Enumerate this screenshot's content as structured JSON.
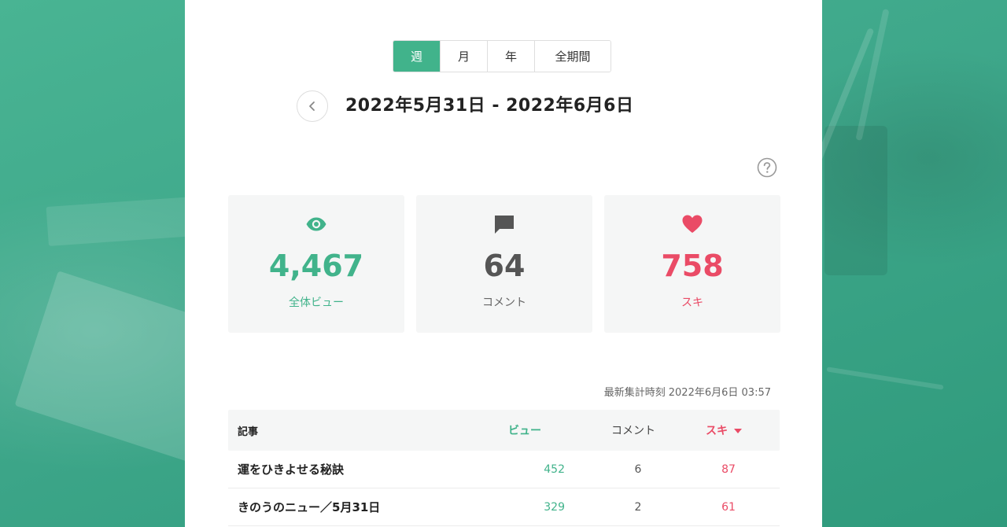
{
  "period_tabs": [
    {
      "label": "週",
      "active": true
    },
    {
      "label": "月",
      "active": false
    },
    {
      "label": "年",
      "active": false
    },
    {
      "label": "全期間",
      "active": false
    }
  ],
  "date_range": "2022年5月31日 - 2022年6月6日",
  "stats": {
    "views": {
      "value": "4,467",
      "label": "全体ビュー",
      "icon": "eye-icon",
      "color": "#41b38b"
    },
    "comments": {
      "value": "64",
      "label": "コメント",
      "icon": "speech-bubble-icon",
      "color": "#555555"
    },
    "likes": {
      "value": "758",
      "label": "スキ",
      "icon": "heart-icon",
      "color": "#ea4b66"
    }
  },
  "updated": {
    "label": "最新集計時刻",
    "value": "2022年6月6日 03:57"
  },
  "table": {
    "headers": {
      "title": "記事",
      "views": "ビュー",
      "comments": "コメント",
      "likes": "スキ"
    },
    "sort": "likes-desc",
    "rows": [
      {
        "title": "運をひきよせる秘訣",
        "views": "452",
        "comments": "6",
        "likes": "87"
      },
      {
        "title": "きのうのニュー／5月31日",
        "views": "329",
        "comments": "2",
        "likes": "61"
      }
    ]
  },
  "colors": {
    "accent": "#41b38b",
    "like": "#ea4b66",
    "background": "#3fa88a"
  }
}
